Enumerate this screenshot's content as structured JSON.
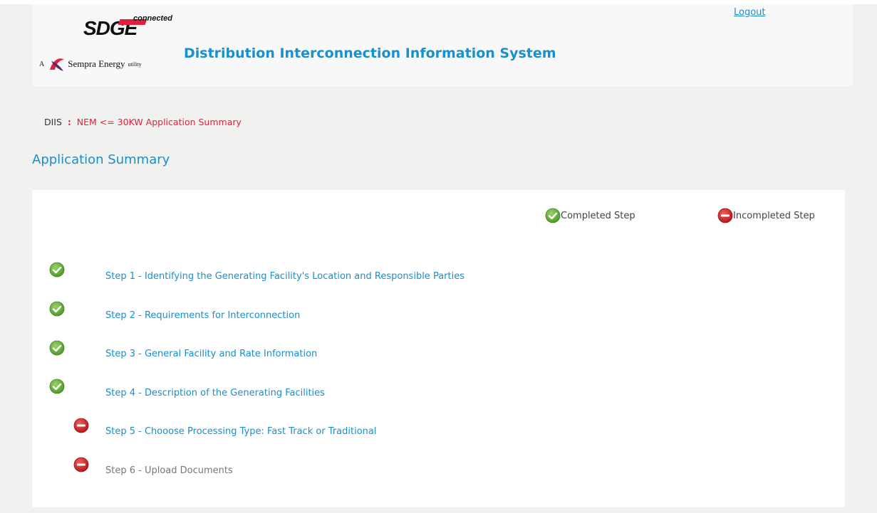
{
  "header": {
    "logo": {
      "brand": "SDGE",
      "tagline": "connected",
      "parent_prefix": "A",
      "parent_name": "Sempra Energy",
      "parent_suffix": "utility"
    },
    "logout_label": "Logout",
    "system_title": "Distribution Interconnection Information System"
  },
  "breadcrumb": {
    "root": "DIIS",
    "separator": ":",
    "current": "NEM <= 30KW Application Summary"
  },
  "page_title": "Application Summary",
  "legend": {
    "completed": "Completed Step",
    "incompleted": "Incompleted Step"
  },
  "steps": [
    {
      "label": "Step 1 - Identifying the Generating Facility's Location and Responsible Parties",
      "status": "completed",
      "icon": "check-circle-icon"
    },
    {
      "label": "Step 2 - Requirements for Interconnection",
      "status": "completed",
      "icon": "check-circle-icon"
    },
    {
      "label": "Step 3 - General Facility and Rate Information",
      "status": "completed",
      "icon": "check-circle-icon"
    },
    {
      "label": "Step 4 - Description of the Generating Facilities",
      "status": "completed",
      "icon": "check-circle-icon"
    },
    {
      "label": "Step 5 - Chooose Processing Type: Fast Track or Traditional",
      "status": "incompleted",
      "icon": "minus-circle-icon"
    },
    {
      "label": "Step 6 - Upload Documents",
      "status": "incompleted",
      "icon": "minus-circle-icon"
    }
  ],
  "colors": {
    "accent": "#1a8fcc",
    "breadcrumb_current": "#e0203c",
    "completed": "#6fb43f",
    "incompleted": "#d9262a"
  }
}
